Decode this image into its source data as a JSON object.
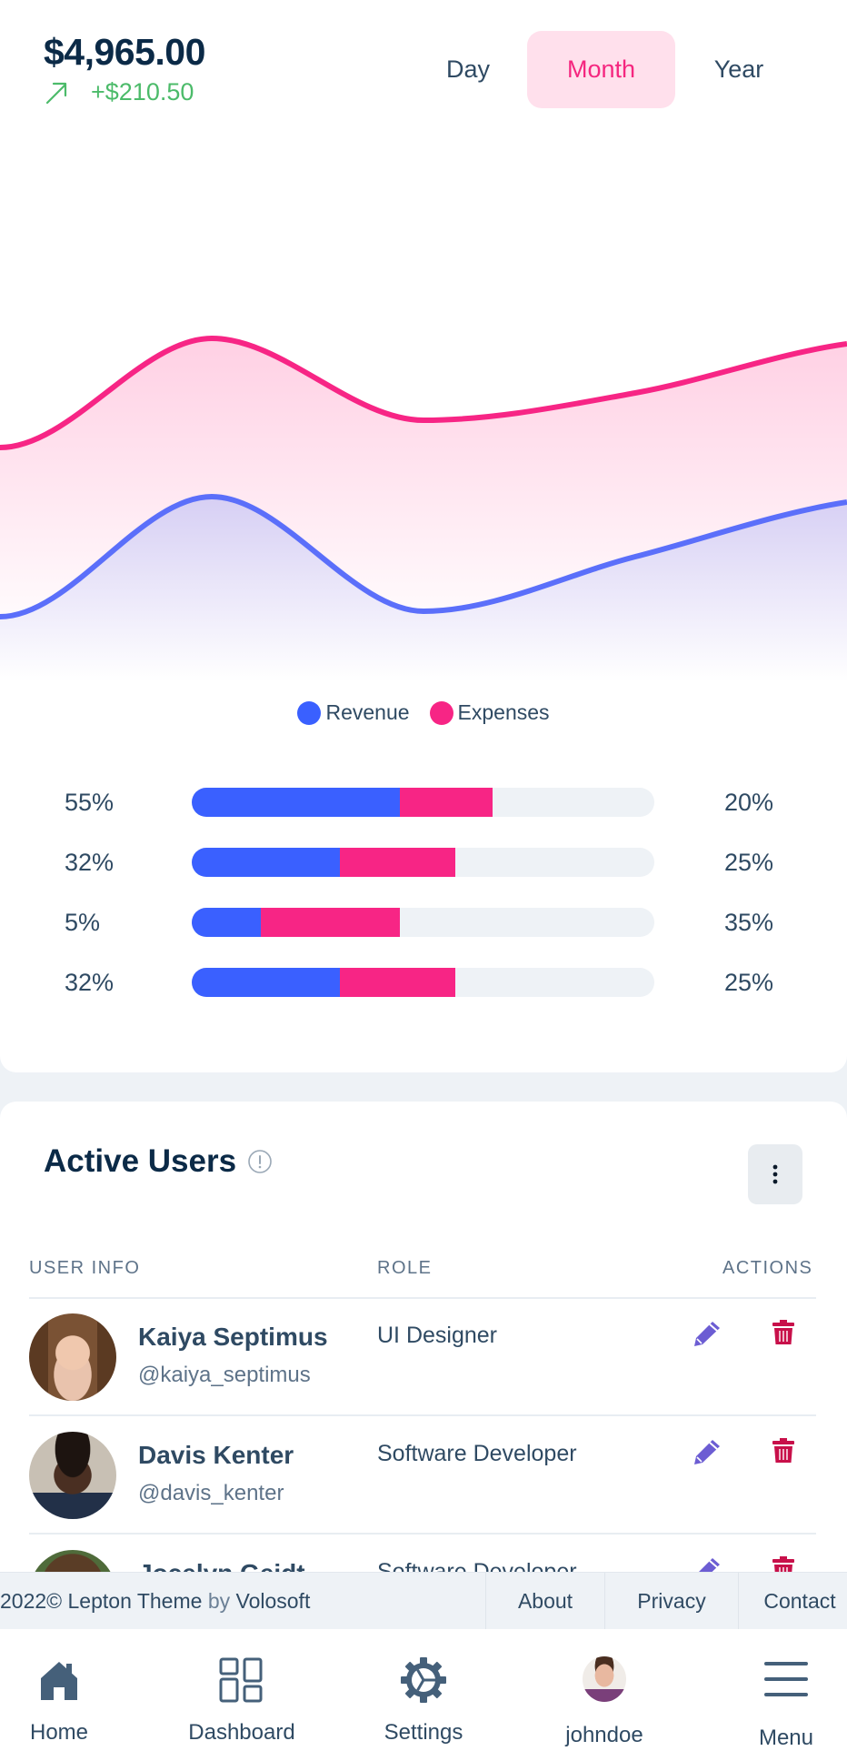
{
  "summary": {
    "amount": "$4,965.00",
    "change": "+$210.50",
    "trend_icon": "arrow-up-right-icon"
  },
  "period_tabs": [
    {
      "label": "Day",
      "active": false
    },
    {
      "label": "Month",
      "active": true
    },
    {
      "label": "Year",
      "active": false
    }
  ],
  "colors": {
    "revenue": "#3a60ff",
    "revenue_line": "#5b6ffa",
    "expenses": "#f72585",
    "track": "#eef2f6",
    "edit": "#6c5dd3",
    "delete": "#c8104a",
    "positive": "#4cbb6a",
    "active_tab_bg": "#ffe0ec"
  },
  "chart_data": {
    "type": "area",
    "title": "",
    "xlabel": "",
    "ylabel": "",
    "x": [
      1,
      2,
      3,
      4,
      5
    ],
    "ylim": [
      0,
      100
    ],
    "grid": false,
    "legend_position": "bottom-center",
    "series": [
      {
        "name": "Revenue",
        "values": [
          12,
          34,
          13,
          23,
          33
        ]
      },
      {
        "name": "Expenses",
        "values": [
          43,
          63,
          48,
          53,
          62
        ]
      }
    ]
  },
  "legend": [
    {
      "label": "Revenue"
    },
    {
      "label": "Expenses"
    }
  ],
  "progress_rows": [
    {
      "left_label": "55%",
      "right_label": "20%",
      "revenue_fill_pct": 45,
      "expenses_fill_pct": 20
    },
    {
      "left_label": "32%",
      "right_label": "25%",
      "revenue_fill_pct": 32,
      "expenses_fill_pct": 25
    },
    {
      "left_label": "5%",
      "right_label": "35%",
      "revenue_fill_pct": 15,
      "expenses_fill_pct": 30
    },
    {
      "left_label": "32%",
      "right_label": "25%",
      "revenue_fill_pct": 32,
      "expenses_fill_pct": 25
    }
  ],
  "active_users": {
    "title": "Active Users",
    "info_icon": "info-circle-icon",
    "menu_icon": "kebab-menu-icon",
    "columns": [
      "USER INFO",
      "ROLE",
      "ACTIONS"
    ],
    "rows": [
      {
        "name": "Kaiya Septimus",
        "handle": "@kaiya_septimus",
        "role": "UI Designer"
      },
      {
        "name": "Davis Kenter",
        "handle": "@davis_kenter",
        "role": "Software Developer"
      },
      {
        "name": "Jocelyn Geidt",
        "handle": "",
        "role": "Software Developer"
      }
    ]
  },
  "footer": {
    "year": "2022©",
    "brand": "Lepton Theme",
    "by": "by",
    "company": "Volosoft",
    "links": [
      "About",
      "Privacy",
      "Contact"
    ]
  },
  "bottom_nav": [
    {
      "label": "Home",
      "icon": "home-icon"
    },
    {
      "label": "Dashboard",
      "icon": "dashboard-icon"
    },
    {
      "label": "Settings",
      "icon": "settings-gear-icon"
    },
    {
      "label": "johndoe",
      "icon": "user-avatar"
    },
    {
      "label": "Menu",
      "icon": "hamburger-menu-icon"
    }
  ]
}
